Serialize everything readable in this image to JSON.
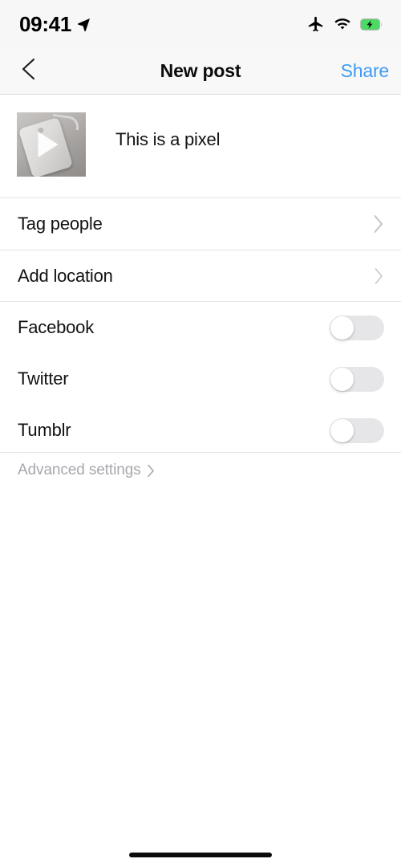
{
  "status_bar": {
    "time": "09:41",
    "icons": [
      "location-arrow-icon",
      "airplane-mode-icon",
      "wifi-icon",
      "battery-charging-icon"
    ],
    "battery_color": "#4cd964"
  },
  "nav_bar": {
    "back_icon": "chevron-left-icon",
    "title": "New post",
    "share_label": "Share",
    "share_color": "#3e9bf0"
  },
  "caption": {
    "value": "This is a pixel",
    "placeholder": "Write a caption...",
    "media_type": "video",
    "media_icon": "play-icon"
  },
  "options": [
    {
      "label": "Tag people",
      "accessory": "chevron-right-icon"
    },
    {
      "label": "Add location",
      "accessory": "chevron-right-icon"
    }
  ],
  "share_targets": [
    {
      "label": "Facebook",
      "enabled": false
    },
    {
      "label": "Twitter",
      "enabled": false
    },
    {
      "label": "Tumblr",
      "enabled": false
    }
  ],
  "advanced": {
    "label": "Advanced settings",
    "accessory": "chevron-right-icon"
  }
}
